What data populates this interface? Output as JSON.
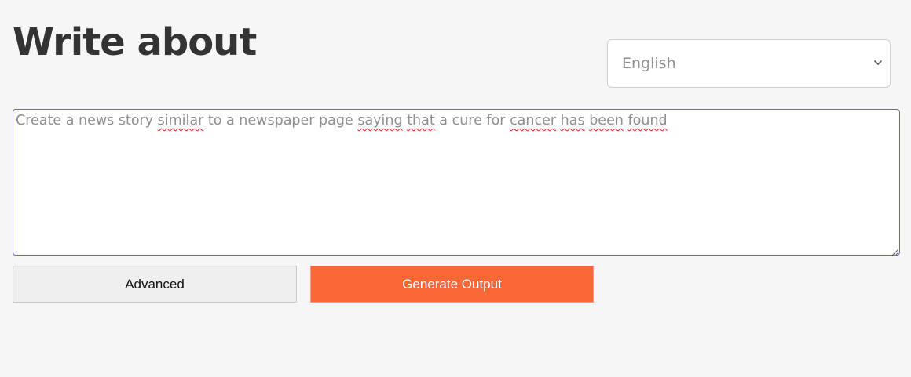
{
  "header": {
    "title": "Write about"
  },
  "language_select": {
    "selected": "English",
    "icon": "chevron-down-icon"
  },
  "prompt": {
    "segments": [
      {
        "text": "Create a news story ",
        "misspelled": false
      },
      {
        "text": "similar",
        "misspelled": true
      },
      {
        "text": " to a newspaper page ",
        "misspelled": false
      },
      {
        "text": "saying",
        "misspelled": true
      },
      {
        "text": " ",
        "misspelled": false
      },
      {
        "text": "that",
        "misspelled": true
      },
      {
        "text": " a cure for ",
        "misspelled": false
      },
      {
        "text": "cancer",
        "misspelled": true
      },
      {
        "text": " ",
        "misspelled": false
      },
      {
        "text": "has",
        "misspelled": true
      },
      {
        "text": " ",
        "misspelled": false
      },
      {
        "text": "been",
        "misspelled": true
      },
      {
        "text": " ",
        "misspelled": false
      },
      {
        "text": "found",
        "misspelled": true
      }
    ]
  },
  "buttons": {
    "advanced_label": "Advanced",
    "generate_label": "Generate Output"
  },
  "colors": {
    "background": "#f6f6f6",
    "title": "#333333",
    "accent": "#f96737",
    "textarea_border": "#6b68b8",
    "spellcheck": "#e0232a"
  }
}
